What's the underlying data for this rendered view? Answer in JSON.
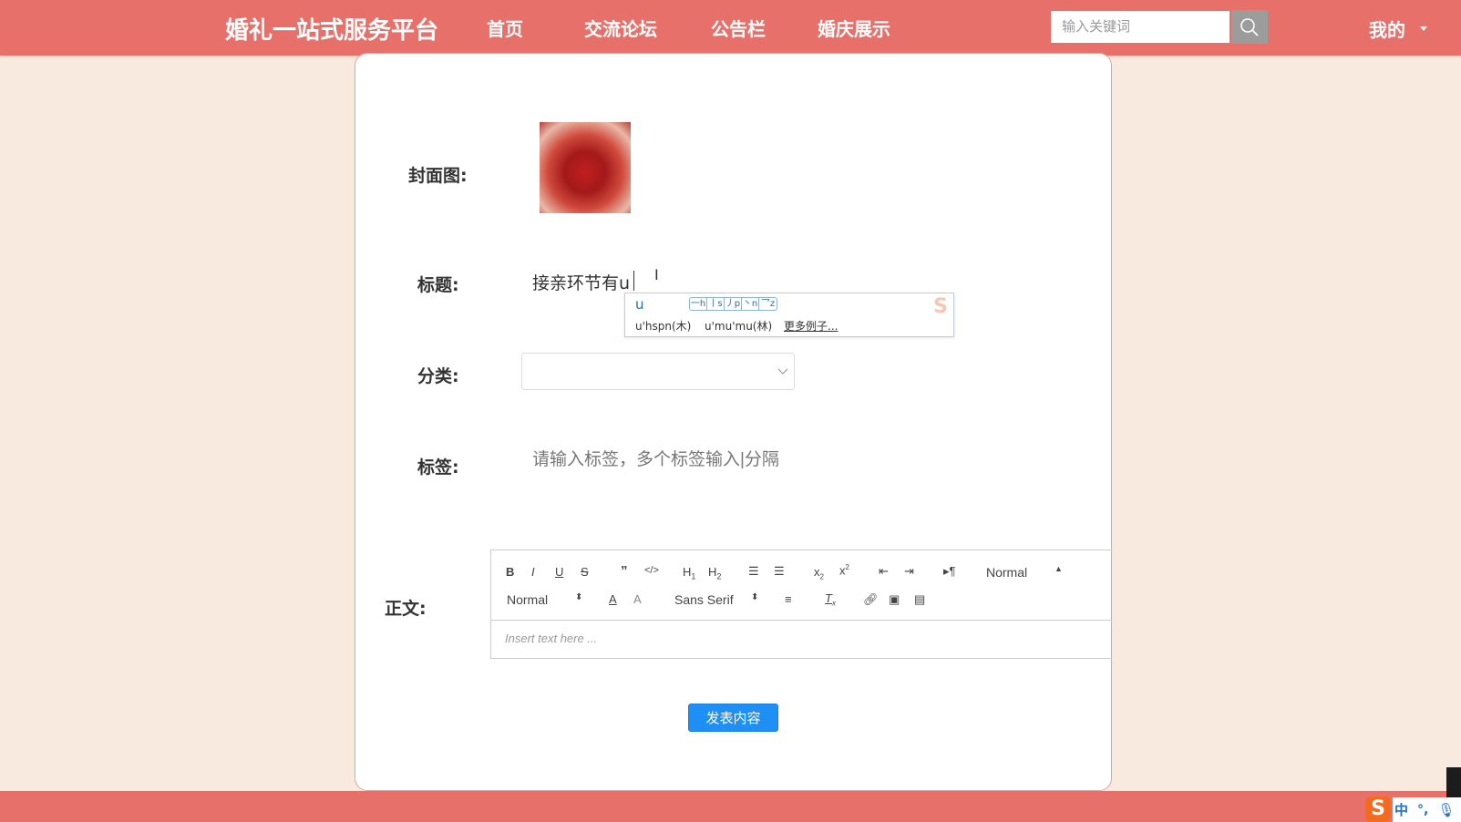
{
  "header": {
    "brand": "婚礼一站式服务平台",
    "nav": [
      "首页",
      "交流论坛",
      "公告栏",
      "婚庆展示"
    ],
    "search_placeholder": "输入关键词",
    "user_menu": "我的"
  },
  "form": {
    "cover_label": "封面图:",
    "title_label": "标题:",
    "title_value": "接亲环节有u",
    "category_label": "分类:",
    "category_value": "",
    "tags_label": "标签:",
    "tags_placeholder": "请输入标签，多个标签输入|分隔",
    "content_label": "正文:",
    "editor": {
      "header_select": "Normal",
      "size_select": "Normal",
      "font_select": "Sans Serif",
      "placeholder": "Insert text here ..."
    },
    "submit_label": "发表内容"
  },
  "ime_popup": {
    "composition": "u",
    "tones": [
      "一h",
      "丨s",
      "丿p",
      "丶n",
      "乛z"
    ],
    "candidates": [
      "u'hspn(木)",
      "u'mu'mu(林)",
      "更多例子..."
    ]
  },
  "taskbar": {
    "ime_mode": "中",
    "punct": "°,"
  },
  "colors": {
    "header": "#e8706a",
    "background": "#f8eadf",
    "primary": "#1e8ff5"
  }
}
